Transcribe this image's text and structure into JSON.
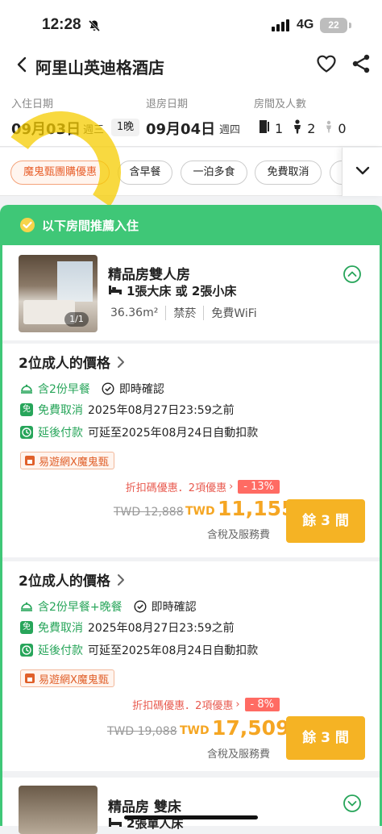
{
  "status": {
    "time": "12:28",
    "network": "4G",
    "battery": "22"
  },
  "header": {
    "title": "阿里山英迪格酒店"
  },
  "dates": {
    "checkin_label": "入住日期",
    "checkin_date": "09月03日",
    "checkin_weekday": "週三",
    "nights": "1晚",
    "checkout_label": "退房日期",
    "checkout_date": "09月04日",
    "checkout_weekday": "週四",
    "guests_label": "房間及人數",
    "rooms": "1",
    "adults": "2",
    "children": "0"
  },
  "filters": [
    {
      "label": "魔鬼甄團購優惠",
      "selected": true
    },
    {
      "label": "含早餐",
      "selected": false
    },
    {
      "label": "一泊多食",
      "selected": false
    },
    {
      "label": "免費取消",
      "selected": false
    }
  ],
  "recommend": {
    "text": "以下房間推薦入住"
  },
  "room": {
    "name": "精品房雙人房",
    "beds": "1張大床 或 2張小床",
    "photo_counter": "1/1",
    "features": [
      "36.36m²",
      "禁菸",
      "免費WiFi"
    ]
  },
  "offers": [
    {
      "title": "2位成人的價格",
      "meal": "含2份早餐",
      "instant": "即時確認",
      "cancel_badge": "免",
      "cancel_label": "免費取消",
      "cancel_text": "2025年08月27日23:59之前",
      "pay_label": "延後付款",
      "pay_text": "可延至2025年08月24日自動扣款",
      "promo": "易遊網X魔鬼甄",
      "discount_text": "折扣碼優惠．2項優惠",
      "discount_tag": "- 13%",
      "orig_price": "TWD 12,888",
      "currency": "TWD",
      "price": "11,155",
      "tax": "含稅及服務費",
      "button": "餘 3 間"
    },
    {
      "title": "2位成人的價格",
      "meal": "含2份早餐+晚餐",
      "instant": "即時確認",
      "cancel_badge": "免",
      "cancel_label": "免費取消",
      "cancel_text": "2025年08月27日23:59之前",
      "pay_label": "延後付款",
      "pay_text": "可延至2025年08月24日自動扣款",
      "promo": "易遊網X魔鬼甄",
      "discount_text": "折扣碼優惠．2項優惠",
      "discount_tag": "- 8%",
      "orig_price": "TWD 19,088",
      "currency": "TWD",
      "price": "17,509",
      "tax": "含稅及服務費",
      "button": "餘 3 間"
    }
  ],
  "room2": {
    "name": "精品房 雙床",
    "beds": "2張單人床"
  }
}
